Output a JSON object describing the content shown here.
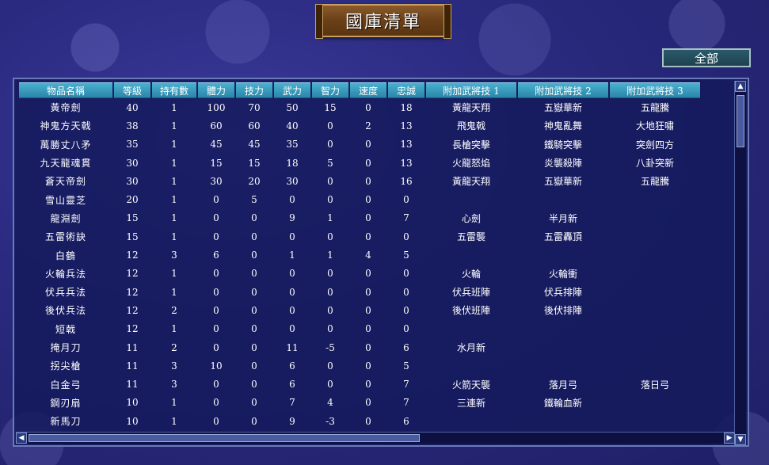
{
  "title": "國庫清單",
  "filter_button_label": "全部",
  "columns": [
    "物品名稱",
    "等級",
    "持有數",
    "體力",
    "技力",
    "武力",
    "智力",
    "速度",
    "忠誠",
    "附加武將技 1",
    "附加武將技 2",
    "附加武將技 3"
  ],
  "rows": [
    [
      "黃帝劍",
      "40",
      "1",
      "100",
      "70",
      "50",
      "15",
      "0",
      "18",
      "黃龍天翔",
      "五嶽華新",
      "五龍騰"
    ],
    [
      "神鬼方天戟",
      "38",
      "1",
      "60",
      "60",
      "40",
      "0",
      "2",
      "13",
      "飛鬼戟",
      "神鬼亂舞",
      "大地狂嘯"
    ],
    [
      "萬勝丈八矛",
      "35",
      "1",
      "45",
      "45",
      "35",
      "0",
      "0",
      "13",
      "長槍突擊",
      "鐵騎突擊",
      "突劍四方"
    ],
    [
      "九天龍魂貫",
      "30",
      "1",
      "15",
      "15",
      "18",
      "5",
      "0",
      "13",
      "火龍怒焰",
      "炎襲殺陣",
      "八卦突新"
    ],
    [
      "蒼天帝劍",
      "30",
      "1",
      "30",
      "20",
      "30",
      "0",
      "0",
      "16",
      "黃龍天翔",
      "五嶽華新",
      "五龍騰"
    ],
    [
      "雪山靈芝",
      "20",
      "1",
      "0",
      "5",
      "0",
      "0",
      "0",
      "0",
      "",
      "",
      ""
    ],
    [
      "龍淵劍",
      "15",
      "1",
      "0",
      "0",
      "9",
      "1",
      "0",
      "7",
      "心劍",
      "半月新",
      ""
    ],
    [
      "五雷術訣",
      "15",
      "1",
      "0",
      "0",
      "0",
      "0",
      "0",
      "0",
      "五雷襲",
      "五雷轟頂",
      ""
    ],
    [
      "白鶴",
      "12",
      "3",
      "6",
      "0",
      "1",
      "1",
      "4",
      "5",
      "",
      "",
      ""
    ],
    [
      "火輪兵法",
      "12",
      "1",
      "0",
      "0",
      "0",
      "0",
      "0",
      "0",
      "火輪",
      "火輪衝",
      ""
    ],
    [
      "伏兵兵法",
      "12",
      "1",
      "0",
      "0",
      "0",
      "0",
      "0",
      "0",
      "伏兵班陣",
      "伏兵排陣",
      ""
    ],
    [
      "後伏兵法",
      "12",
      "2",
      "0",
      "0",
      "0",
      "0",
      "0",
      "0",
      "後伏班陣",
      "後伏排陣",
      ""
    ],
    [
      "短戟",
      "12",
      "1",
      "0",
      "0",
      "0",
      "0",
      "0",
      "0",
      "",
      "",
      ""
    ],
    [
      "掩月刀",
      "11",
      "2",
      "0",
      "0",
      "11",
      "-5",
      "0",
      "6",
      "水月新",
      "",
      ""
    ],
    [
      "拐尖槍",
      "11",
      "3",
      "10",
      "0",
      "6",
      "0",
      "0",
      "5",
      "",
      "",
      ""
    ],
    [
      "白金弓",
      "11",
      "3",
      "0",
      "0",
      "6",
      "0",
      "0",
      "7",
      "火箭天襲",
      "落月弓",
      "落日弓"
    ],
    [
      "鋼刃扇",
      "10",
      "1",
      "0",
      "0",
      "7",
      "4",
      "0",
      "7",
      "三連新",
      "鐵輪血新",
      ""
    ],
    [
      "新馬刀",
      "10",
      "1",
      "0",
      "0",
      "9",
      "-3",
      "0",
      "6",
      "",
      "",
      ""
    ]
  ],
  "icons": {
    "scroll_up": "triangle-up",
    "scroll_down": "triangle-down",
    "scroll_left": "triangle-left",
    "scroll_right": "triangle-right"
  },
  "colors": {
    "header_bg": "#2a86a8",
    "panel_bg": "#141a5a",
    "banner_bg": "#6b4018"
  }
}
